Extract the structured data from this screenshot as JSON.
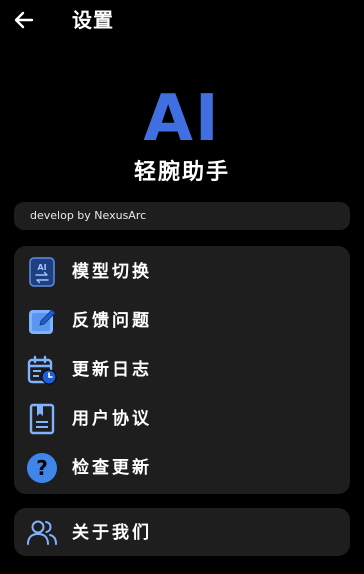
{
  "header": {
    "title": "设置"
  },
  "logo": {
    "text": "AI"
  },
  "app_name": "轻腕助手",
  "developer": "develop by NexusArc",
  "menu": {
    "items": [
      {
        "label": "模型切换",
        "icon": "ai-switch-icon"
      },
      {
        "label": "反馈问题",
        "icon": "feedback-edit-icon"
      },
      {
        "label": "更新日志",
        "icon": "calendar-log-icon"
      },
      {
        "label": "用户协议",
        "icon": "document-bookmark-icon"
      },
      {
        "label": "检查更新",
        "icon": "question-circle-icon"
      }
    ]
  },
  "about": {
    "label": "关于我们",
    "icon": "users-icon"
  },
  "colors": {
    "background": "#000000",
    "card": "#1e1e1e",
    "accent": "#3f6fe0",
    "icon_light": "#7fb3ff",
    "icon_dark": "#1f5fd6"
  }
}
